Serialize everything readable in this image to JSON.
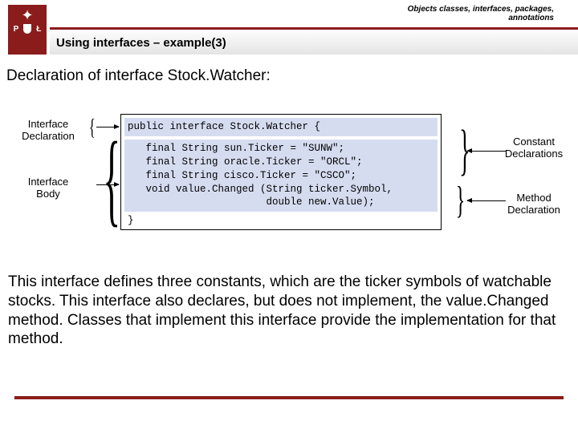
{
  "header": {
    "top_label_line1": "Objects classes, interfaces, packages,",
    "top_label_line2": "annotations",
    "title": "Using interfaces – example(3)",
    "logo_left": "P",
    "logo_right": "Ł"
  },
  "intro": "Declaration of interface Stock.Watcher:",
  "labels": {
    "interface_declaration_l1": "Interface",
    "interface_declaration_l2": "Declaration",
    "interface_body_l1": "Interface",
    "interface_body_l2": "Body",
    "constant_decl_l1": "Constant",
    "constant_decl_l2": "Declarations",
    "method_decl_l1": "Method",
    "method_decl_l2": "Declaration"
  },
  "code": {
    "line1": "public interface Stock.Watcher {",
    "block2": "   final String sun.Ticker = \"SUNW\";\n   final String oracle.Ticker = \"ORCL\";\n   final String cisco.Ticker = \"CSCO\";\n   void value.Changed (String ticker.Symbol,\n                       double new.Value);",
    "close": "}"
  },
  "body_text": "This interface defines three constants, which are the ticker symbols of watchable stocks. This interface also declares, but does not implement, the value.Changed method. Classes that implement this interface provide the implementation for that method."
}
